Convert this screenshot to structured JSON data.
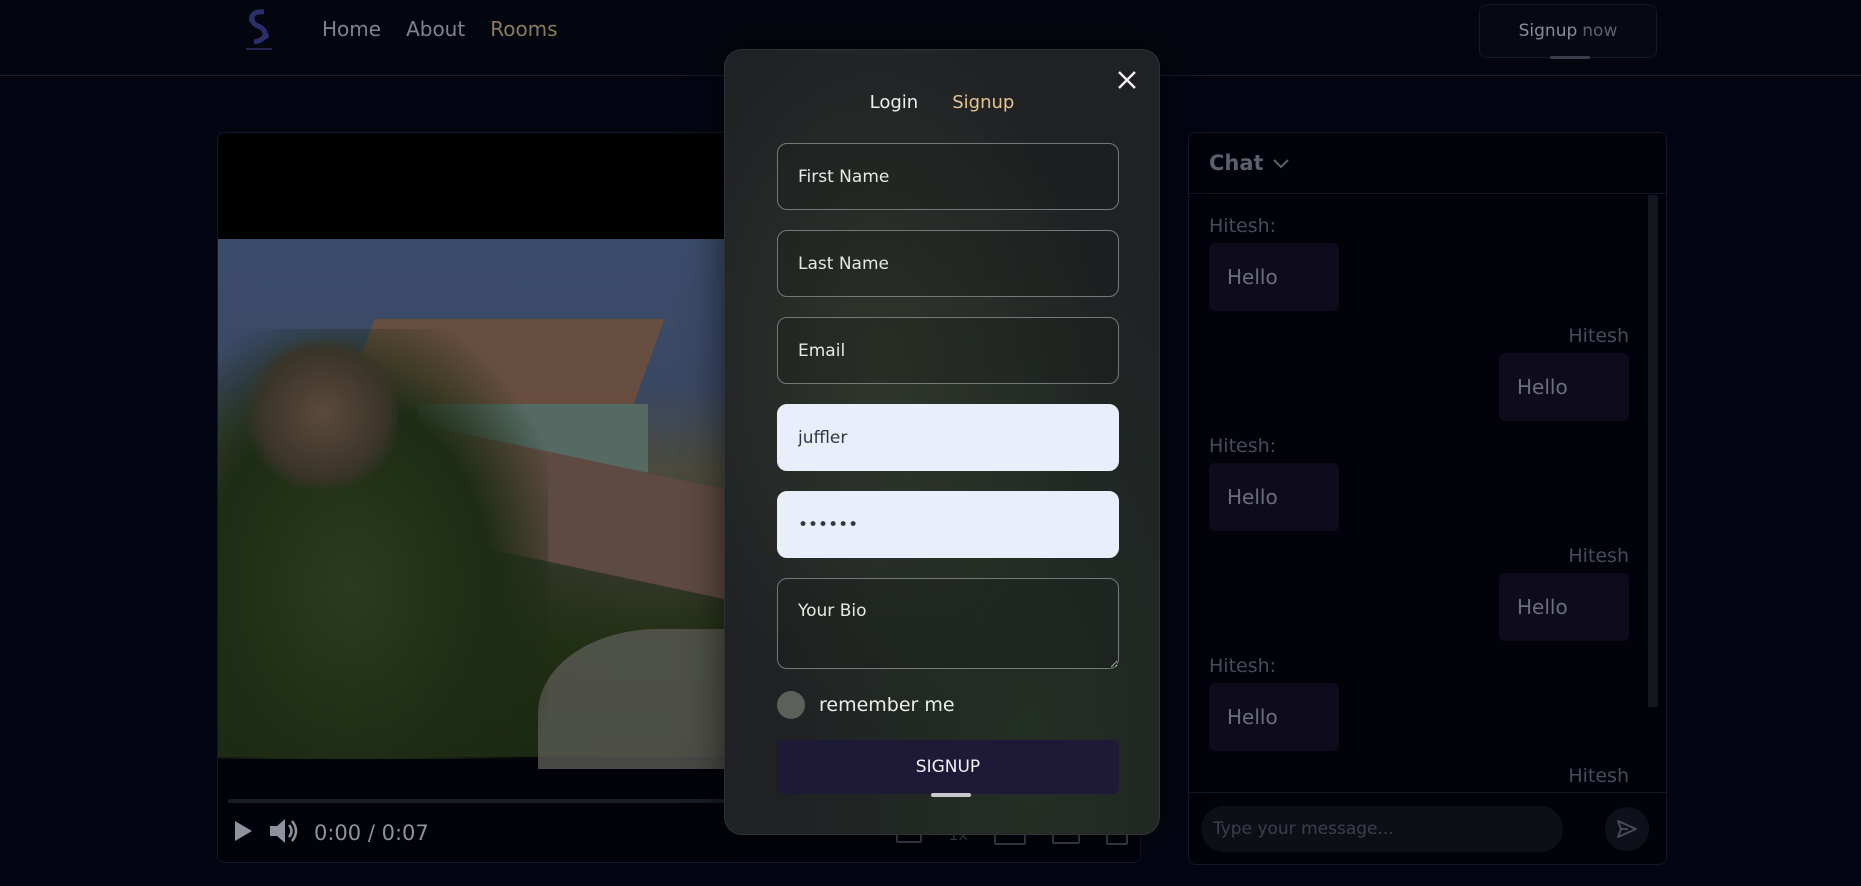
{
  "nav": {
    "items": [
      {
        "label": "Home"
      },
      {
        "label": "About"
      },
      {
        "label": "Rooms"
      }
    ],
    "signup_label": "Signup",
    "signup_suffix": "now"
  },
  "video": {
    "time_current": "0:00",
    "time_separator": "/",
    "time_total": "0:07",
    "speed_label": "1x"
  },
  "chat": {
    "title": "Chat",
    "messages": [
      {
        "sender": "Hitesh:",
        "text": "Hello",
        "side": "left"
      },
      {
        "sender": "Hitesh",
        "text": "Hello",
        "side": "right"
      },
      {
        "sender": "Hitesh:",
        "text": "Hello",
        "side": "left"
      },
      {
        "sender": "Hitesh",
        "text": "Hello",
        "side": "right"
      },
      {
        "sender": "Hitesh:",
        "text": "Hello",
        "side": "left"
      },
      {
        "sender": "Hitesh",
        "text": "",
        "side": "right"
      }
    ],
    "input_placeholder": "Type your message..."
  },
  "modal": {
    "tabs": {
      "login": "Login",
      "signup": "Signup"
    },
    "fields": {
      "first_name": {
        "placeholder": "First Name",
        "value": ""
      },
      "last_name": {
        "placeholder": "Last Name",
        "value": ""
      },
      "email": {
        "placeholder": "Email",
        "value": ""
      },
      "username": {
        "placeholder": "",
        "value": "juffler"
      },
      "password": {
        "placeholder": "",
        "value": "••••••"
      },
      "bio": {
        "placeholder": "Your Bio",
        "value": ""
      }
    },
    "remember_label": "remember me",
    "submit_label": "SIGNUP"
  },
  "colors": {
    "accent": "#e8c38f",
    "submit_bg": "#1f1938",
    "filled_field_bg": "#e9eefb"
  }
}
